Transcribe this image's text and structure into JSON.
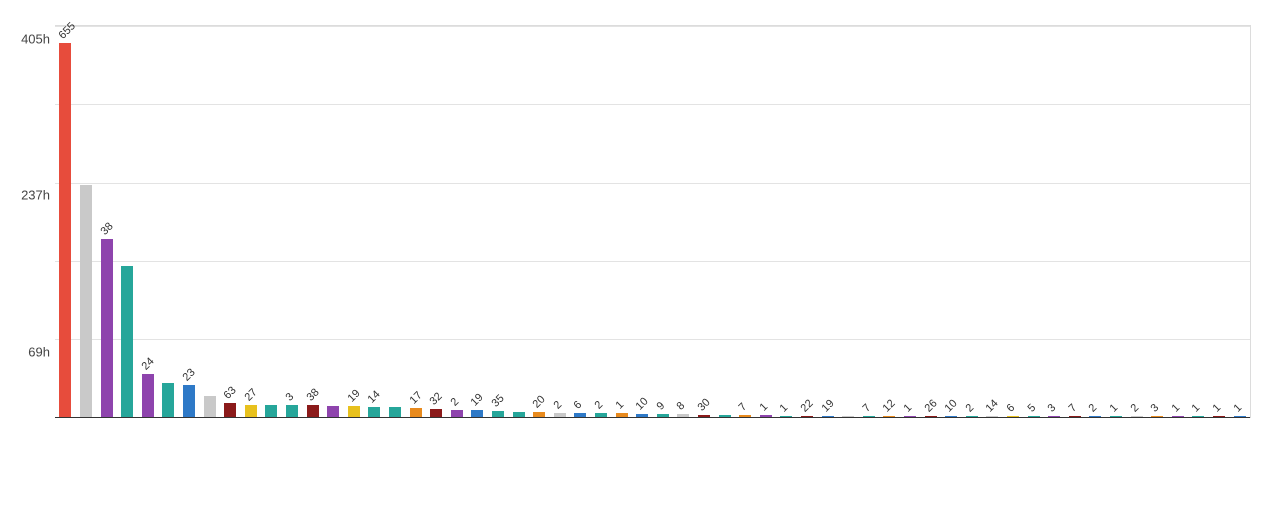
{
  "chart_data": {
    "type": "bar",
    "title": "",
    "xlabel": "",
    "ylabel": "",
    "y_ticks": [
      "69h",
      "237h",
      "405h"
    ],
    "ylim": [
      0,
      440
    ],
    "bar_label_rotation_deg": -45,
    "x_labels_obscured": true,
    "series": [
      {
        "label": "655",
        "value": 420,
        "color": "#e74c3c"
      },
      {
        "label": "",
        "value": 260,
        "color": "#c9c9c9"
      },
      {
        "label": "38",
        "value": 200,
        "color": "#8e44ad"
      },
      {
        "label": "",
        "value": 170,
        "color": "#26a69a"
      },
      {
        "label": "24",
        "value": 48,
        "color": "#8e44ad"
      },
      {
        "label": "",
        "value": 38,
        "color": "#26a69a"
      },
      {
        "label": "23",
        "value": 36,
        "color": "#2e79c7"
      },
      {
        "label": "",
        "value": 24,
        "color": "#c9c9c9"
      },
      {
        "label": "63",
        "value": 16,
        "color": "#8b1a1a"
      },
      {
        "label": "27",
        "value": 14,
        "color": "#e8c11d"
      },
      {
        "label": "",
        "value": 14,
        "color": "#26a69a"
      },
      {
        "label": "3",
        "value": 14,
        "color": "#26a69a"
      },
      {
        "label": "38",
        "value": 13,
        "color": "#8b1a1a"
      },
      {
        "label": "",
        "value": 12,
        "color": "#8e44ad"
      },
      {
        "label": "19",
        "value": 12,
        "color": "#e8c11d"
      },
      {
        "label": "14",
        "value": 11,
        "color": "#26a69a"
      },
      {
        "label": "",
        "value": 11,
        "color": "#26a69a"
      },
      {
        "label": "17",
        "value": 10,
        "color": "#e88a1d"
      },
      {
        "label": "32",
        "value": 9,
        "color": "#8b1a1a"
      },
      {
        "label": "2",
        "value": 8,
        "color": "#8e44ad"
      },
      {
        "label": "19",
        "value": 8,
        "color": "#2e79c7"
      },
      {
        "label": "35",
        "value": 7,
        "color": "#26a69a"
      },
      {
        "label": "",
        "value": 6,
        "color": "#26a69a"
      },
      {
        "label": "20",
        "value": 6,
        "color": "#e88a1d"
      },
      {
        "label": "2",
        "value": 5,
        "color": "#c9c9c9"
      },
      {
        "label": "6",
        "value": 5,
        "color": "#2e79c7"
      },
      {
        "label": "2",
        "value": 4,
        "color": "#26a69a"
      },
      {
        "label": "1",
        "value": 4,
        "color": "#e88a1d"
      },
      {
        "label": "10",
        "value": 3,
        "color": "#2e79c7"
      },
      {
        "label": "9",
        "value": 3,
        "color": "#26a69a"
      },
      {
        "label": "8",
        "value": 3,
        "color": "#c9c9c9"
      },
      {
        "label": "30",
        "value": 2,
        "color": "#8b1a1a"
      },
      {
        "label": "",
        "value": 2,
        "color": "#26a69a"
      },
      {
        "label": "7",
        "value": 2,
        "color": "#e88a1d"
      },
      {
        "label": "1",
        "value": 2,
        "color": "#8e44ad"
      },
      {
        "label": "1",
        "value": 1,
        "color": "#26a69a"
      },
      {
        "label": "22",
        "value": 1,
        "color": "#8b1a1a"
      },
      {
        "label": "19",
        "value": 1,
        "color": "#2e79c7"
      },
      {
        "label": "",
        "value": 1,
        "color": "#c9c9c9"
      },
      {
        "label": "7",
        "value": 1,
        "color": "#26a69a"
      },
      {
        "label": "12",
        "value": 1,
        "color": "#e88a1d"
      },
      {
        "label": "1",
        "value": 1,
        "color": "#8e44ad"
      },
      {
        "label": "26",
        "value": 1,
        "color": "#8b1a1a"
      },
      {
        "label": "10",
        "value": 1,
        "color": "#2e79c7"
      },
      {
        "label": "2",
        "value": 1,
        "color": "#26a69a"
      },
      {
        "label": "14",
        "value": 1,
        "color": "#c9c9c9"
      },
      {
        "label": "6",
        "value": 1,
        "color": "#e8c11d"
      },
      {
        "label": "5",
        "value": 1,
        "color": "#26a69a"
      },
      {
        "label": "3",
        "value": 1,
        "color": "#8e44ad"
      },
      {
        "label": "7",
        "value": 1,
        "color": "#8b1a1a"
      },
      {
        "label": "2",
        "value": 1,
        "color": "#2e79c7"
      },
      {
        "label": "1",
        "value": 1,
        "color": "#26a69a"
      },
      {
        "label": "2",
        "value": 1,
        "color": "#c9c9c9"
      },
      {
        "label": "3",
        "value": 1,
        "color": "#e88a1d"
      },
      {
        "label": "1",
        "value": 1,
        "color": "#8e44ad"
      },
      {
        "label": "1",
        "value": 1,
        "color": "#26a69a"
      },
      {
        "label": "1",
        "value": 1,
        "color": "#8b1a1a"
      },
      {
        "label": "1",
        "value": 1,
        "color": "#2e79c7"
      }
    ],
    "x_label_placeholder": "      "
  }
}
